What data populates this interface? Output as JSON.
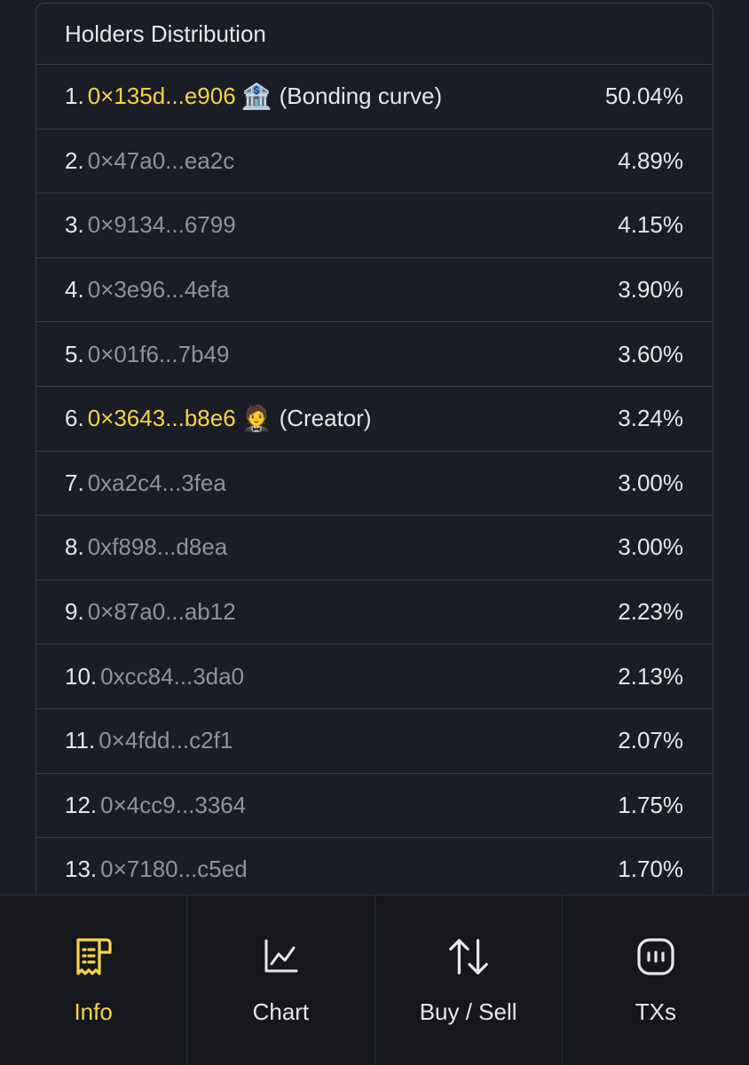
{
  "panel": {
    "title": "Holders Distribution",
    "holders": [
      {
        "rank": "1.",
        "address": "0×135d...e906",
        "emoji": "🏦",
        "tag": "(Bonding curve)",
        "percent": "50.04%",
        "highlight": true
      },
      {
        "rank": "2.",
        "address": "0×47a0...ea2c",
        "emoji": "",
        "tag": "",
        "percent": "4.89%",
        "highlight": false
      },
      {
        "rank": "3.",
        "address": "0×9134...6799",
        "emoji": "",
        "tag": "",
        "percent": "4.15%",
        "highlight": false
      },
      {
        "rank": "4.",
        "address": "0×3e96...4efa",
        "emoji": "",
        "tag": "",
        "percent": "3.90%",
        "highlight": false
      },
      {
        "rank": "5.",
        "address": "0×01f6...7b49",
        "emoji": "",
        "tag": "",
        "percent": "3.60%",
        "highlight": false
      },
      {
        "rank": "6.",
        "address": "0×3643...b8e6",
        "emoji": "🤵",
        "tag": "(Creator)",
        "percent": "3.24%",
        "highlight": true
      },
      {
        "rank": "7.",
        "address": "0xa2c4...3fea",
        "emoji": "",
        "tag": "",
        "percent": "3.00%",
        "highlight": false
      },
      {
        "rank": "8.",
        "address": "0xf898...d8ea",
        "emoji": "",
        "tag": "",
        "percent": "3.00%",
        "highlight": false
      },
      {
        "rank": "9.",
        "address": "0×87a0...ab12",
        "emoji": "",
        "tag": "",
        "percent": "2.23%",
        "highlight": false
      },
      {
        "rank": "10.",
        "address": "0xcc84...3da0",
        "emoji": "",
        "tag": "",
        "percent": "2.13%",
        "highlight": false
      },
      {
        "rank": "11.",
        "address": "0×4fdd...c2f1",
        "emoji": "",
        "tag": "",
        "percent": "2.07%",
        "highlight": false
      },
      {
        "rank": "12.",
        "address": "0×4cc9...3364",
        "emoji": "",
        "tag": "",
        "percent": "1.75%",
        "highlight": false
      },
      {
        "rank": "13.",
        "address": "0×7180...c5ed",
        "emoji": "",
        "tag": "",
        "percent": "1.70%",
        "highlight": false
      }
    ]
  },
  "nav": {
    "items": [
      {
        "label": "Info",
        "icon": "receipt-icon",
        "active": true
      },
      {
        "label": "Chart",
        "icon": "line-chart-icon",
        "active": false
      },
      {
        "label": "Buy / Sell",
        "icon": "swap-arrows-icon",
        "active": false
      },
      {
        "label": "TXs",
        "icon": "transactions-icon",
        "active": false
      }
    ]
  },
  "colors": {
    "background": "#1b1d24",
    "accent": "#f5d547",
    "muted_text": "#8f929a",
    "text": "#e6e7ea",
    "border": "#3a3d46"
  }
}
